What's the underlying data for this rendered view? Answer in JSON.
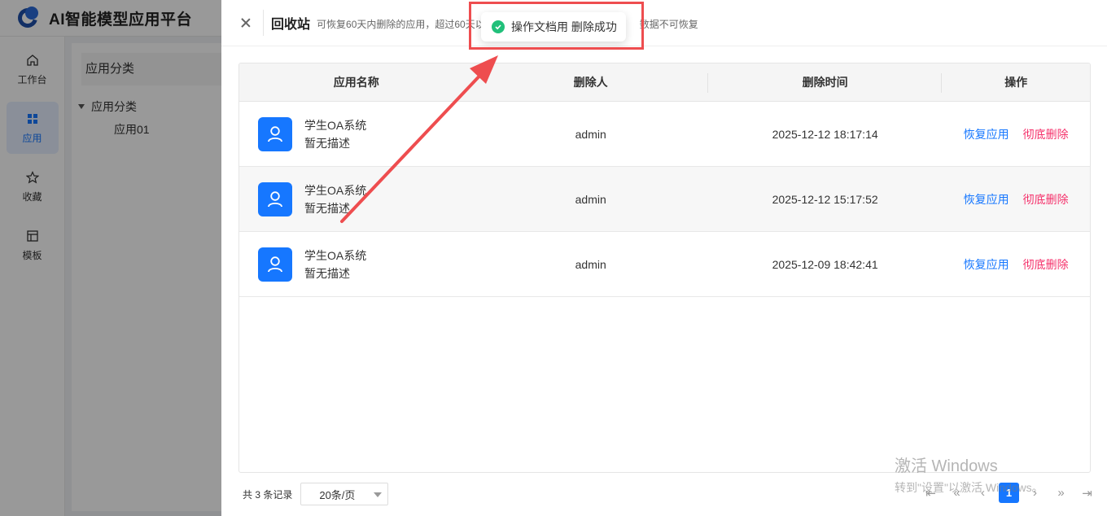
{
  "app": {
    "title": "AI智能模型应用平台"
  },
  "nav": [
    {
      "label": "工作台",
      "icon": "home-icon",
      "active": false
    },
    {
      "label": "应用",
      "icon": "grid-icon",
      "active": true
    },
    {
      "label": "收藏",
      "icon": "star-icon",
      "active": false
    },
    {
      "label": "模板",
      "icon": "layout-icon",
      "active": false
    }
  ],
  "category": {
    "header": "应用分类",
    "tree_root": "应用分类",
    "tree_child": "应用01"
  },
  "drawer": {
    "title": "回收站",
    "subtitle": "可恢复60天内删除的应用，超过60天以",
    "subtitle_tail": "数据不可恢复"
  },
  "table": {
    "columns": [
      "应用名称",
      "删除人",
      "删除时间",
      "操作"
    ],
    "rows": [
      {
        "name": "学生OA系统",
        "desc": "暂无描述",
        "deleter": "admin",
        "time": "2025-12-12 18:17:14",
        "restore": "恢复应用",
        "delete": "彻底删除"
      },
      {
        "name": "学生OA系统",
        "desc": "暂无描述",
        "deleter": "admin",
        "time": "2025-12-12 15:17:52",
        "restore": "恢复应用",
        "delete": "彻底删除"
      },
      {
        "name": "学生OA系统",
        "desc": "暂无描述",
        "deleter": "admin",
        "time": "2025-12-09 18:42:41",
        "restore": "恢复应用",
        "delete": "彻底删除"
      }
    ]
  },
  "footer": {
    "total": "共 3 条记录",
    "page_size": "20条/页",
    "current_page": "1"
  },
  "toast": {
    "message": "操作文档用 删除成功"
  },
  "watermark": {
    "line1": "激活 Windows",
    "line2": "转到\"设置\"以激活 Windows。"
  },
  "colors": {
    "accent": "#1677ff",
    "danger": "#f5316b",
    "success": "#21c07a",
    "annotation": "#ee4d4f"
  }
}
